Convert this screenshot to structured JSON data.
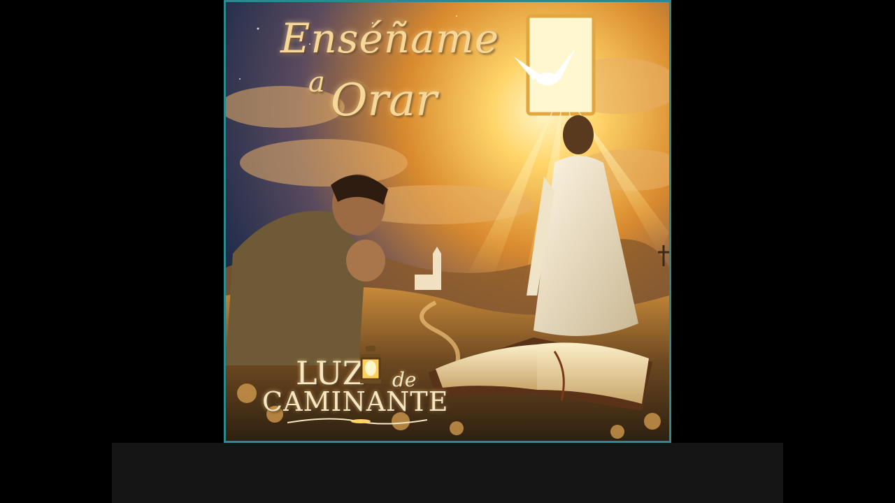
{
  "cover": {
    "title_line1": "Enséñame",
    "title_line2": "a",
    "title_line3": "Orar",
    "brand_luz": "LUZ",
    "brand_de": "de",
    "brand_caminante": "CAMINANTE"
  },
  "colors": {
    "page_background": "#000000",
    "bottom_bar": "#151515",
    "frame_border": "#2a8a90",
    "title_gold": "#f6d99a",
    "sky_dark": "#1d2b4a",
    "glow": "#ffd36a"
  }
}
